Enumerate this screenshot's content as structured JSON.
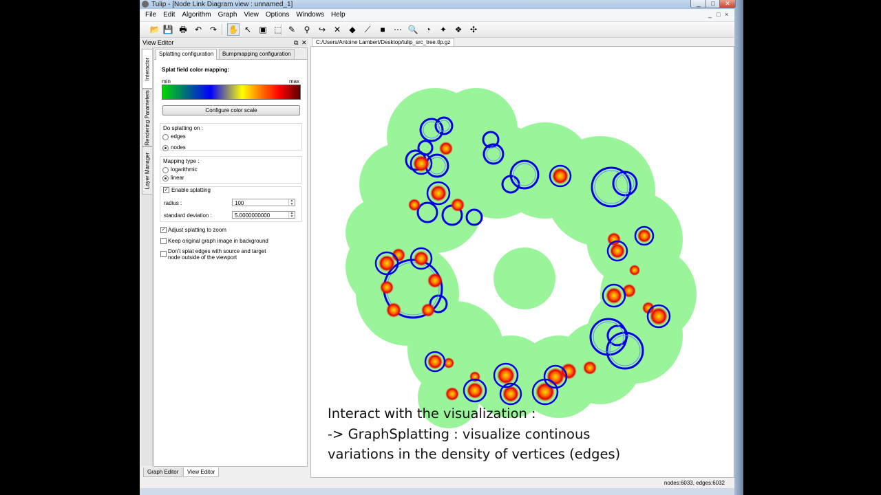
{
  "window": {
    "title": "Tulip - [Node Link Diagram view : unnamed_1]",
    "controls": {
      "minimize": "_",
      "maximize": "□",
      "close": "✕"
    }
  },
  "menubar": {
    "items": [
      "File",
      "Edit",
      "Algorithm",
      "Graph",
      "View",
      "Options",
      "Windows",
      "Help"
    ],
    "mdi_controls": [
      "_",
      "□",
      "×"
    ]
  },
  "toolbar": {
    "buttons": [
      {
        "name": "open-icon",
        "glyph": "📂"
      },
      {
        "name": "save-icon",
        "glyph": "💾"
      },
      {
        "name": "print-icon",
        "glyph": "🖶"
      },
      {
        "name": "undo-icon",
        "glyph": "↶"
      },
      {
        "name": "redo-icon",
        "glyph": "↷"
      },
      {
        "name": "navigate-hand-icon",
        "glyph": "✋"
      },
      {
        "name": "get-info-icon",
        "glyph": "↖"
      },
      {
        "name": "select-icon",
        "glyph": "▣"
      },
      {
        "name": "rectangle-selection-icon",
        "glyph": "⬚"
      },
      {
        "name": "pencil-icon",
        "glyph": "✎"
      },
      {
        "name": "magic-selection-icon",
        "glyph": "⚲"
      },
      {
        "name": "path-finder-icon",
        "glyph": "↪"
      },
      {
        "name": "delete-icon",
        "glyph": "✕"
      },
      {
        "name": "add-node-icon",
        "glyph": "◆"
      },
      {
        "name": "add-edge-icon",
        "glyph": "⟋"
      },
      {
        "name": "square-node-icon",
        "glyph": "■"
      },
      {
        "name": "edit-edge-bends-icon",
        "glyph": "⋯"
      },
      {
        "name": "zoom-box-icon",
        "glyph": "🔍"
      },
      {
        "name": "lasso-icon",
        "glyph": "◔"
      },
      {
        "name": "fisheye-icon",
        "glyph": "✦"
      },
      {
        "name": "graph-splatting-icon",
        "glyph": "❖"
      },
      {
        "name": "neighborhood-icon",
        "glyph": "✣"
      }
    ]
  },
  "dock": {
    "title": "View Editor",
    "float_label": "⧉",
    "close_label": "✕",
    "side_tabs": [
      "Interactor",
      "Rendering Parameters",
      "Layer Manager"
    ],
    "tabs": [
      "Splatting configuration",
      "Bumpmapping configuration"
    ],
    "splat": {
      "heading": "Splat field color mapping:",
      "min_label": "min",
      "max_label": "max",
      "configure_button": "Configure color scale",
      "do_splatting_label": "Do splatting on :",
      "opt_edges": "edges",
      "opt_nodes": "nodes",
      "mapping_type_label": "Mapping type :",
      "opt_log": "logarithmic",
      "opt_linear": "linear",
      "enable_label": "Enable splatting",
      "radius_label": "radius :",
      "radius_value": "100",
      "stddev_label": "standard deviation :",
      "stddev_value": "5.0000000000",
      "adjust_label": "Adjust splatting to zoom",
      "keep_label": "Keep original graph image in background",
      "dont_splat_line1": "Don't splat edges with source and target",
      "dont_splat_line2": "node outside of the viewport"
    },
    "bottom_tabs": [
      "Graph Editor",
      "View Editor"
    ]
  },
  "view": {
    "tab": "C:/Users/Antoine Lambert/Desktop/tulip_src_tree.tlp.gz",
    "caption": [
      "Interact with the visualization :",
      "-> GraphSplatting : visualize continous",
      "variations in the density of vertices (edges)"
    ]
  },
  "status": {
    "text": "nodes:6033, edges:6032"
  },
  "colors": {
    "halo": "#9af59a",
    "ring_blue": "#0000e0",
    "hot_red": "#ff2000",
    "hot_yellow": "#ffe000"
  }
}
